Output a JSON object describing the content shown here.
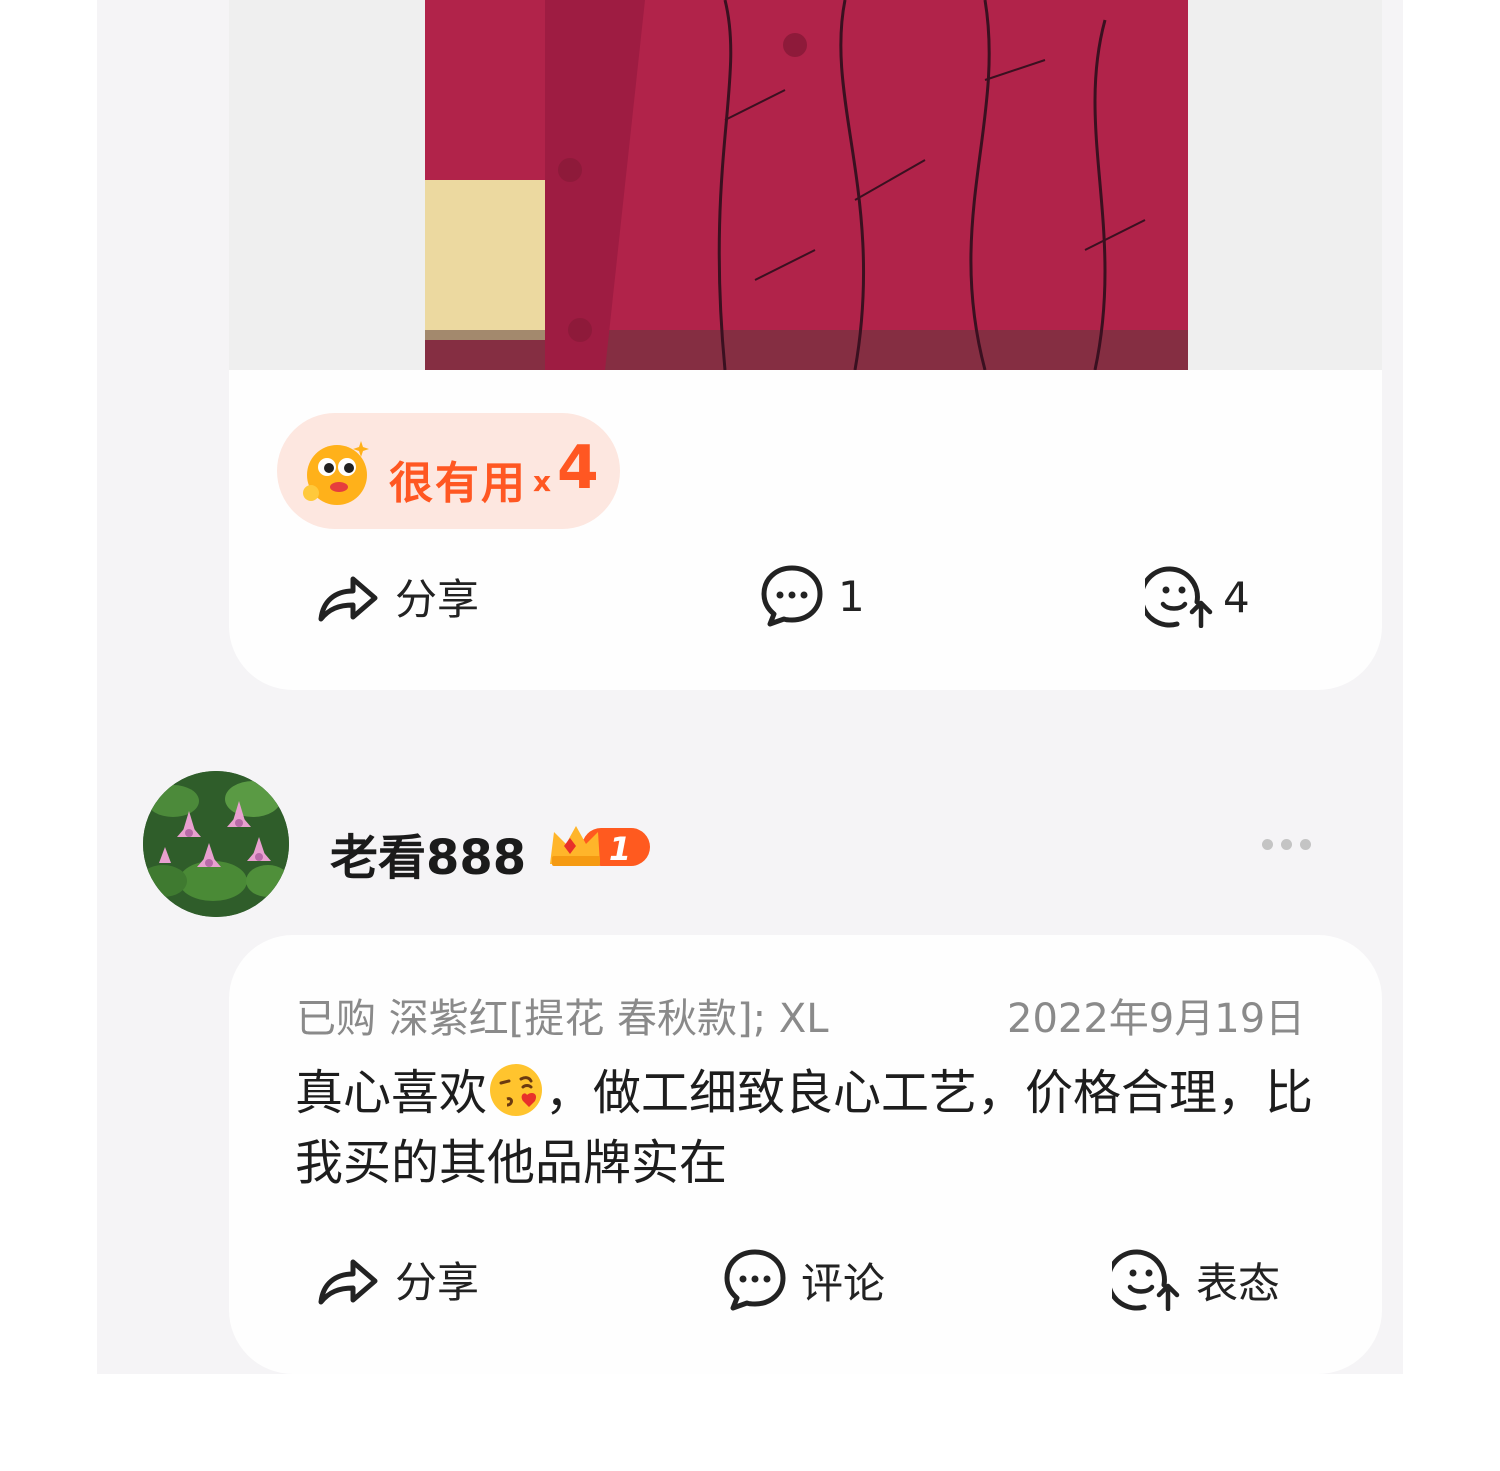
{
  "review1": {
    "useful_label": "很有用",
    "useful_x": "x",
    "useful_count": "4",
    "actions": {
      "share_label": "分享",
      "comment_count": "1",
      "react_count": "4"
    }
  },
  "review2": {
    "username": "老看888",
    "vip_level": "1",
    "spec": "已购 深紫红[提花 春秋款]; XL",
    "date": "2022年9月19日",
    "text_part1": "真心喜欢",
    "text_part2": "，做工细致良心工艺，价格合理，比我买的其他品牌实在",
    "actions": {
      "share_label": "分享",
      "comment_label": "评论",
      "react_label": "表态"
    }
  },
  "colors": {
    "accent": "#ff5722",
    "badge_bg": "#fde7e0",
    "text_primary": "#1d1d1d",
    "text_secondary": "#8a8a8a",
    "panel_bg": "#f5f4f6"
  }
}
